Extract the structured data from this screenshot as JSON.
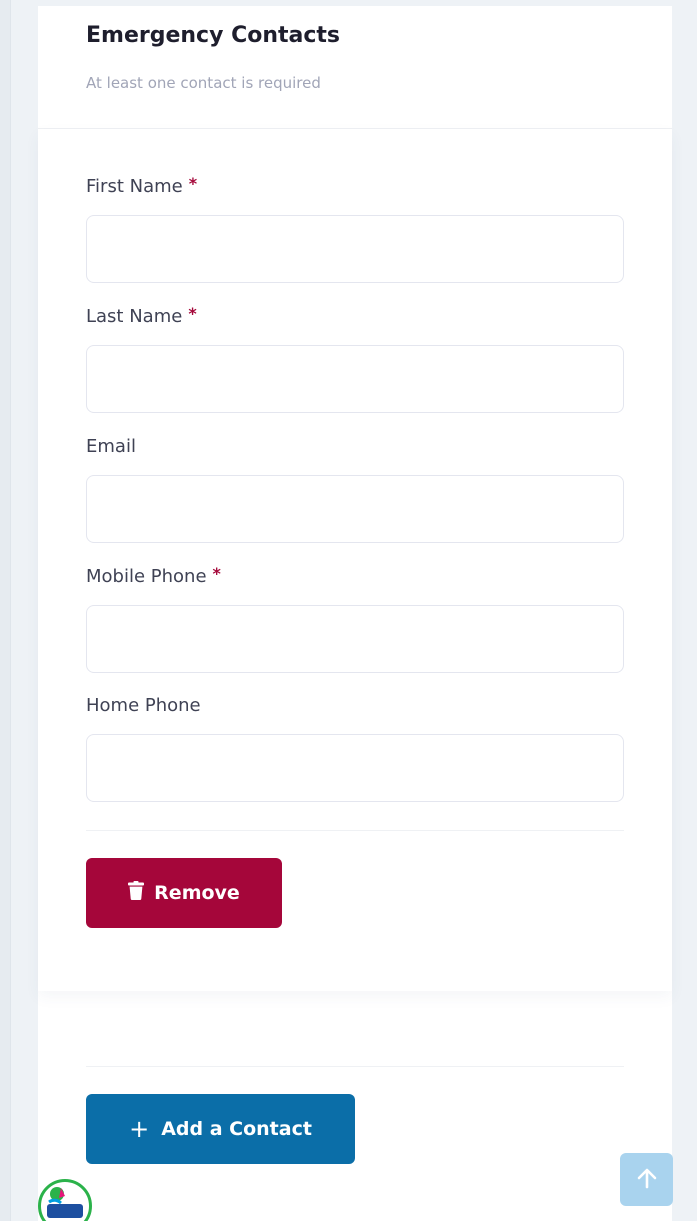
{
  "section": {
    "title": "Emergency Contacts",
    "subtitle": "At least one contact is required"
  },
  "form": {
    "required_marker": "*",
    "fields": [
      {
        "label": "First Name",
        "required": true,
        "value": ""
      },
      {
        "label": "Last Name",
        "required": true,
        "value": ""
      },
      {
        "label": "Email",
        "required": false,
        "value": ""
      },
      {
        "label": "Mobile Phone",
        "required": true,
        "value": ""
      },
      {
        "label": "Home Phone",
        "required": false,
        "value": ""
      }
    ],
    "remove_label": "Remove",
    "remove_icon": "trash-icon"
  },
  "actions": {
    "add_contact_label": "Add a Contact",
    "add_icon": "plus-icon",
    "scroll_top_icon": "arrow-up-icon"
  },
  "colors": {
    "remove_button": "#a5063a",
    "add_button": "#0b6ea8",
    "required_marker": "#a5083a",
    "scroll_top": "#a9d3ee"
  }
}
